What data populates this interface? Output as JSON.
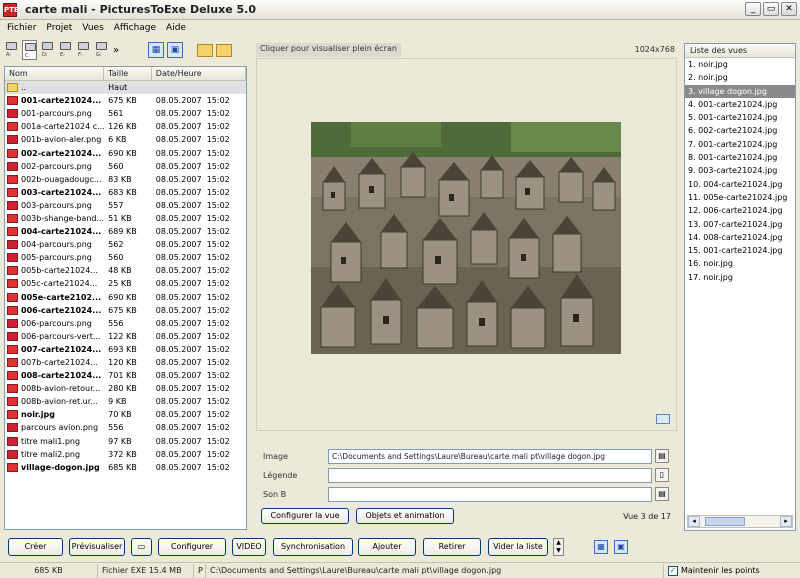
{
  "window": {
    "title": "carte mali - PicturesToExe Deluxe 5.0",
    "app_icon_text": "PTE"
  },
  "menu": [
    "Fichier",
    "Projet",
    "Vues",
    "Affichage",
    "Aide"
  ],
  "toolbar": {
    "drives": [
      "A:",
      "C:",
      "D:",
      "E:",
      "F:",
      "G:"
    ],
    "more": "»"
  },
  "filelist": {
    "headers": {
      "name": "Nom",
      "size": "Taille",
      "date": "Date/Heure"
    },
    "up": {
      "name": "..",
      "size": "Haut"
    },
    "files": [
      {
        "name": "001-carte21024...",
        "size": "675 KB",
        "date": "08.05.2007",
        "time": "15:02",
        "bold": true,
        "type": "jpg"
      },
      {
        "name": "001-parcours.png",
        "size": "561",
        "date": "08.05.2007",
        "time": "15:02",
        "bold": false,
        "type": "png"
      },
      {
        "name": "001a-carte21024 c...",
        "size": "126 KB",
        "date": "08.05.2007",
        "time": "15:02",
        "bold": false,
        "type": "jpg"
      },
      {
        "name": "001b-avion-aler.png",
        "size": "6 KB",
        "date": "08.05.2007",
        "time": "15:02",
        "bold": false,
        "type": "png"
      },
      {
        "name": "002-carte21024...",
        "size": "690 KB",
        "date": "08.05.2007",
        "time": "15:02",
        "bold": true,
        "type": "jpg"
      },
      {
        "name": "002-parcours.png",
        "size": "560",
        "date": "08.05.2007",
        "time": "15:02",
        "bold": false,
        "type": "png"
      },
      {
        "name": "002b-ouagadougc...",
        "size": "83 KB",
        "date": "08.05.2007",
        "time": "15:02",
        "bold": false,
        "type": "jpg"
      },
      {
        "name": "003-carte21024...",
        "size": "683 KB",
        "date": "08.05.2007",
        "time": "15:02",
        "bold": true,
        "type": "jpg"
      },
      {
        "name": "003-parcours.png",
        "size": "557",
        "date": "08.05.2007",
        "time": "15:02",
        "bold": false,
        "type": "png"
      },
      {
        "name": "003b-shange-band...",
        "size": "51 KB",
        "date": "08.05.2007",
        "time": "15:02",
        "bold": false,
        "type": "jpg"
      },
      {
        "name": "004-carte21024...",
        "size": "689 KB",
        "date": "08.05.2007",
        "time": "15:02",
        "bold": true,
        "type": "jpg"
      },
      {
        "name": "004-parcours.png",
        "size": "562",
        "date": "08.05.2007",
        "time": "15:02",
        "bold": false,
        "type": "png"
      },
      {
        "name": "005-parcours.png",
        "size": "560",
        "date": "08.05.2007",
        "time": "15:02",
        "bold": false,
        "type": "png"
      },
      {
        "name": "005b-carte21024...",
        "size": "48 KB",
        "date": "08.05.2007",
        "time": "15:02",
        "bold": false,
        "type": "jpg"
      },
      {
        "name": "005c-carte21024...",
        "size": "25 KB",
        "date": "08.05.2007",
        "time": "15:02",
        "bold": false,
        "type": "jpg"
      },
      {
        "name": "005e-carte2102...",
        "size": "690 KB",
        "date": "08.05.2007",
        "time": "15:02",
        "bold": true,
        "type": "jpg"
      },
      {
        "name": "006-carte21024...",
        "size": "675 KB",
        "date": "08.05.2007",
        "time": "15:02",
        "bold": true,
        "type": "jpg"
      },
      {
        "name": "006-parcours.png",
        "size": "556",
        "date": "08.05.2007",
        "time": "15:02",
        "bold": false,
        "type": "png"
      },
      {
        "name": "006-parcours-vert...",
        "size": "122 KB",
        "date": "08.05.2007",
        "time": "15:02",
        "bold": false,
        "type": "png"
      },
      {
        "name": "007-carte21024...",
        "size": "693 KB",
        "date": "08.05.2007",
        "time": "15:02",
        "bold": true,
        "type": "jpg"
      },
      {
        "name": "007b-carte21024...",
        "size": "120 KB",
        "date": "08.05.2007",
        "time": "15:02",
        "bold": false,
        "type": "jpg"
      },
      {
        "name": "008-carte21024...",
        "size": "701 KB",
        "date": "08.05.2007",
        "time": "15:02",
        "bold": true,
        "type": "jpg"
      },
      {
        "name": "008b-avion-retour...",
        "size": "280 KB",
        "date": "08.05.2007",
        "time": "15:02",
        "bold": false,
        "type": "jpg"
      },
      {
        "name": "008b-avion-ret.ur...",
        "size": "9 KB",
        "date": "08.05.2007",
        "time": "15:02",
        "bold": false,
        "type": "jpg"
      },
      {
        "name": "noir.jpg",
        "size": "70 KB",
        "date": "08.05.2007",
        "time": "15:02",
        "bold": true,
        "type": "jpg"
      },
      {
        "name": "parcours avion.png",
        "size": "556",
        "date": "08.05.2007",
        "time": "15:02",
        "bold": false,
        "type": "png"
      },
      {
        "name": "titre mali1.png",
        "size": "97 KB",
        "date": "08.05.2007",
        "time": "15:02",
        "bold": false,
        "type": "png"
      },
      {
        "name": "titre mali2.png",
        "size": "372 KB",
        "date": "08.05.2007",
        "time": "15:02",
        "bold": false,
        "type": "png"
      },
      {
        "name": "village-dogon.jpg",
        "size": "685 KB",
        "date": "08.05.2007",
        "time": "15:02",
        "bold": true,
        "type": "jpg"
      }
    ]
  },
  "preview": {
    "title": "Cliquer pour visualiser plein écran",
    "size": "1024x768"
  },
  "fields": {
    "image_label": "Image",
    "image_value": "C:\\Documents and Settings\\Laure\\Bureau\\carte mali pt\\village dogon.jpg",
    "legende_label": "Légende",
    "legende_value": "",
    "son_label": "Son B",
    "son_value": "",
    "configure_view": "Configurer la vue",
    "objects_animation": "Objets et animation",
    "count": "Vue 3 de 17"
  },
  "right_list": {
    "header": "Liste des vues",
    "items": [
      "1. noir.jpg",
      "2. noir.jpg",
      "3. village dogon.jpg",
      "4. 001-carte21024.jpg",
      "5. 001-carte21024.jpg",
      "6. 002-carte21024.jpg",
      "7. 001-carte21024.jpg",
      "8. 001-carte21024.jpg",
      "9. 003-carte21024.jpg",
      "10. 004-carte21024.jpg",
      "11. 005e-carte21024.jpg",
      "12. 006-carte21024.jpg",
      "13. 007-carte21024.jpg",
      "14. 008-carte21024.jpg",
      "15. 001-carte21024.jpg",
      "16. noir.jpg",
      "17. noir.jpg"
    ],
    "selected_index": 2
  },
  "bottom_buttons": {
    "create": "Créer",
    "preview": "Prévisualiser",
    "configure": "Configurer",
    "video": "VIDEO",
    "sync": "Synchronisation",
    "add": "Ajouter",
    "remove": "Retirer",
    "clear": "Vider la liste"
  },
  "status": {
    "size": "685 KB",
    "exe": "Fichier EXE 15.4 MB",
    "p": "P",
    "path": "C:\\Documents and Settings\\Laure\\Bureau\\carte mali pt\\village dogon.jpg",
    "keep_points": "Maintenir les points",
    "keep_points_checked": true
  }
}
